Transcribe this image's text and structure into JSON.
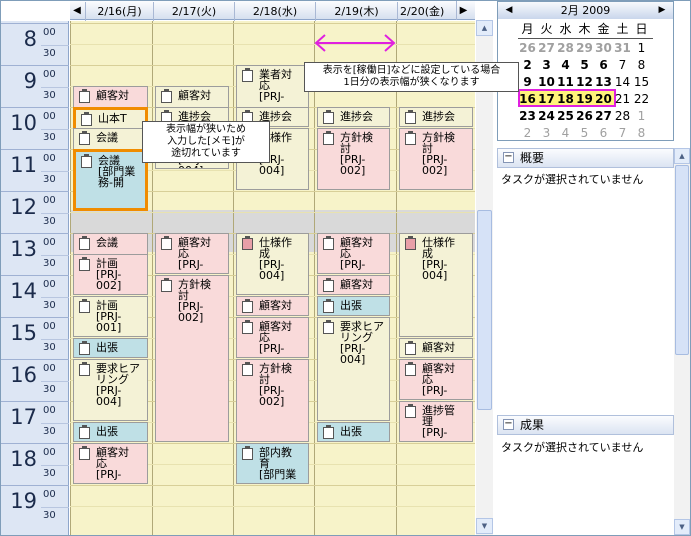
{
  "header": {
    "days": [
      "2/16(月)",
      "2/17(火)",
      "2/18(水)",
      "2/19(木)",
      "2/20(金)"
    ],
    "prev": "◀",
    "next": "▶"
  },
  "times": {
    "hours": [
      "8",
      "9",
      "10",
      "11",
      "12",
      "13",
      "14",
      "15",
      "16",
      "17",
      "18",
      "19"
    ],
    "m00": "00",
    "m30": "30"
  },
  "events": {
    "mon": [
      {
        "t": "顧客対",
        "c": "pink"
      },
      {
        "t": "山本T",
        "c": "yel"
      },
      {
        "t": "会議",
        "c": "yel"
      },
      {
        "t": "会議\n[部門業\n務-開",
        "c": "blue"
      },
      {
        "t": "会議",
        "c": "pink"
      },
      {
        "t": "計画\n[PRJ-\n002]",
        "c": "pink"
      },
      {
        "t": "計画\n[PRJ-\n001]",
        "c": "yel"
      },
      {
        "t": "出張",
        "c": "blue"
      },
      {
        "t": "要求ヒア\nリング\n[PRJ-\n004]",
        "c": "yel"
      },
      {
        "t": "出張",
        "c": "blue"
      },
      {
        "t": "顧客対\n応\n[PRJ-",
        "c": "pink"
      }
    ],
    "tue": [
      {
        "t": "顧客対",
        "c": "yel"
      },
      {
        "t": "進捗会",
        "c": "yel"
      },
      {
        "t": "方針検\n討\n[PRJ-\n004]",
        "c": "yel"
      },
      {
        "t": "顧客対\n応\n[PRJ-",
        "c": "pink"
      },
      {
        "t": "方針検\n討\n[PRJ-\n002]",
        "c": "pink"
      }
    ],
    "wed": [
      {
        "t": "業者対\n応\n[PRJ-",
        "c": "yel"
      },
      {
        "t": "進捗会",
        "c": "yel"
      },
      {
        "t": "仕様作\n成\n[PRJ-\n004]",
        "c": "yel"
      },
      {
        "t": "仕様作\n成\n[PRJ-\n004]",
        "c": "yel"
      },
      {
        "t": "顧客対",
        "c": "pink"
      },
      {
        "t": "顧客対\n応\n[PRJ-",
        "c": "pink"
      },
      {
        "t": "方針検\n討\n[PRJ-\n002]",
        "c": "pink"
      },
      {
        "t": "部内教\n育\n[部門業",
        "c": "blue"
      }
    ],
    "thu": [
      {
        "t": "進捗会",
        "c": "yel"
      },
      {
        "t": "方針検\n討\n[PRJ-\n002]",
        "c": "pink"
      },
      {
        "t": "顧客対\n応\n[PRJ-",
        "c": "pink"
      },
      {
        "t": "顧客対",
        "c": "pink"
      },
      {
        "t": "出張",
        "c": "blue"
      },
      {
        "t": "要求ヒア\nリング\n[PRJ-\n004]",
        "c": "yel"
      },
      {
        "t": "出張",
        "c": "blue"
      }
    ],
    "fri": [
      {
        "t": "進捗会",
        "c": "yel"
      },
      {
        "t": "方針検\n討\n[PRJ-\n002]",
        "c": "pink"
      },
      {
        "t": "仕様作\n成\n[PRJ-\n004]",
        "c": "yel"
      },
      {
        "t": "顧客対",
        "c": "yel"
      },
      {
        "t": "顧客対\n応\n[PRJ-",
        "c": "pink"
      },
      {
        "t": "進捗管\n理\n[PRJ-",
        "c": "pink"
      }
    ]
  },
  "tooltips": {
    "note": "表示幅が狭いため\n入力した[メモ]が\n途切れています",
    "workday": "表示を[稼働日]などに設定している場合\n1日分の表示幅が狭くなります"
  },
  "calendar": {
    "title": "2月 2009",
    "prev": "◀",
    "next": "▶",
    "weekdays": [
      "月",
      "火",
      "水",
      "木",
      "金",
      "土",
      "日"
    ],
    "rows": [
      [
        "26",
        "27",
        "28",
        "29",
        "30",
        "31",
        "1"
      ],
      [
        "2",
        "3",
        "4",
        "5",
        "6",
        "7",
        "8"
      ],
      [
        "9",
        "10",
        "11",
        "12",
        "13",
        "14",
        "15"
      ],
      [
        "16",
        "17",
        "18",
        "19",
        "20",
        "21",
        "22"
      ],
      [
        "23",
        "24",
        "25",
        "26",
        "27",
        "28",
        "1"
      ],
      [
        "2",
        "3",
        "4",
        "5",
        "6",
        "7",
        "8"
      ]
    ]
  },
  "panels": {
    "summary_title": "概要",
    "summary_text": "タスクが選択されていません",
    "result_title": "成果",
    "result_text": "タスクが選択されていません",
    "toggle": "−"
  },
  "colors": {
    "accent_select": "#f08c00",
    "week_highlight": "#e020e0",
    "grid_bg": "#f7f3c9"
  }
}
